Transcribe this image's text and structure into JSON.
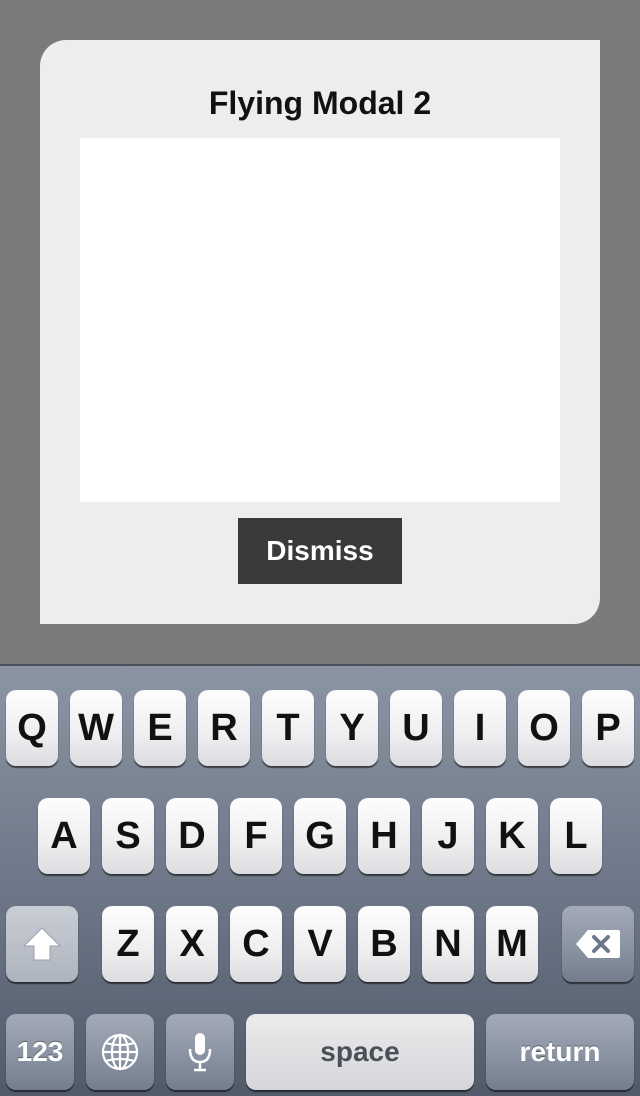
{
  "modal": {
    "title": "Flying Modal 2",
    "text_area_value": "",
    "dismiss_label": "Dismiss"
  },
  "keyboard": {
    "row1": [
      "Q",
      "W",
      "E",
      "R",
      "T",
      "Y",
      "U",
      "I",
      "O",
      "P"
    ],
    "row2": [
      "A",
      "S",
      "D",
      "F",
      "G",
      "H",
      "J",
      "K",
      "L"
    ],
    "row3": [
      "Z",
      "X",
      "C",
      "V",
      "B",
      "N",
      "M"
    ],
    "numbers_label": "123",
    "space_label": "space",
    "return_label": "return",
    "shift_icon": "shift-up-arrow-icon",
    "delete_icon": "backspace-icon",
    "globe_icon": "globe-icon",
    "mic_icon": "microphone-icon"
  }
}
